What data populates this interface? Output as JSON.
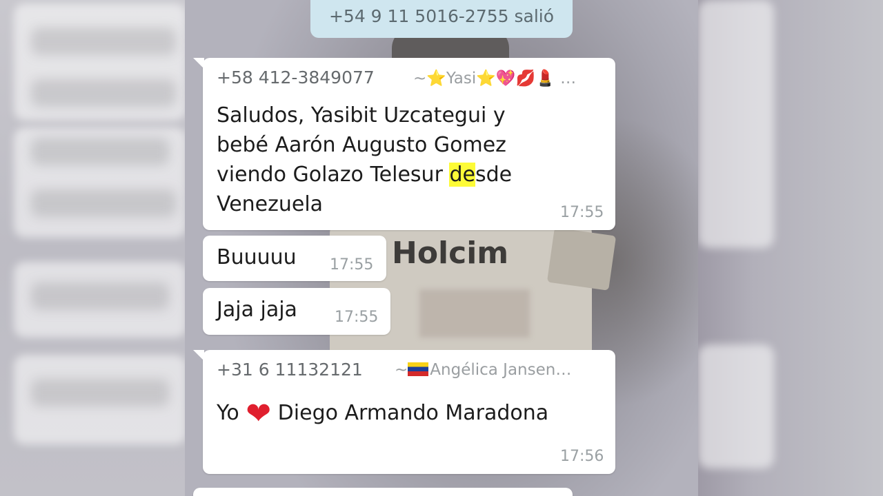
{
  "system_message": "+54 9 11 5016-2755 salió",
  "shirt_sponsor": "Holcim",
  "messages": [
    {
      "sender": "+58 412-3849077",
      "alias": "~⭐Yasi⭐💖💋💄 …",
      "lines": [
        "Saludos, Yasibit Uzcategui y",
        "bebé Aarón Augusto Gomez",
        "viendo Golazo Telesur ",
        "de",
        "sde",
        "Venezuela"
      ],
      "time": "17:55"
    },
    {
      "text": "Buuuuu",
      "time": "17:55"
    },
    {
      "text": "Jaja jaja",
      "time": "17:55"
    },
    {
      "sender": "+31 6 11132121",
      "alias": "~🇻🇪Angélica Jansen…",
      "alias_text": "Angélica Jansen…",
      "text_before": "Yo",
      "text_after": "Diego Armando Maradona",
      "time": "17:56"
    }
  ],
  "colors": {
    "bubble": "#ffffff",
    "system_pill": "#cfe6ef",
    "highlight": "#fdfb37"
  }
}
